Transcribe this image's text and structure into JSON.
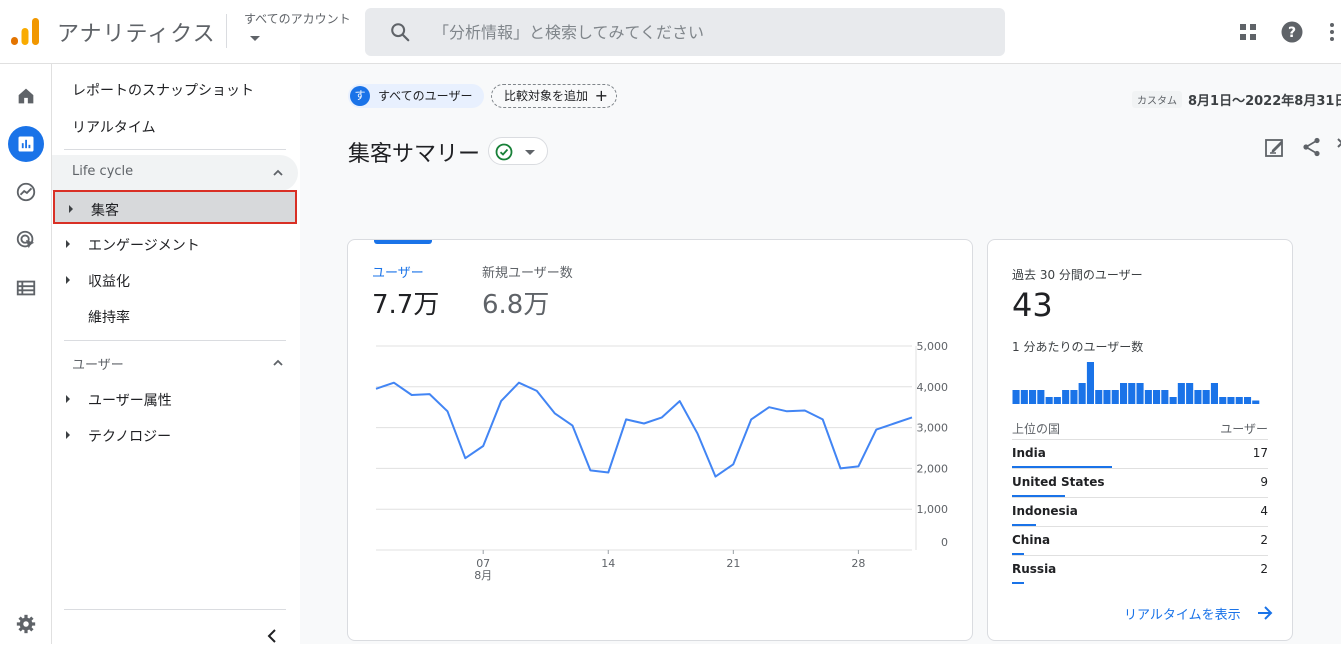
{
  "header": {
    "app_title": "アナリティクス",
    "account_label": "すべてのアカウント",
    "search_placeholder": "「分析情報」と検索してみてください"
  },
  "sidebar": {
    "top_items": [
      "レポートのスナップショット",
      "リアルタイム"
    ],
    "sections": [
      {
        "title": "Life cycle",
        "items": [
          "集客",
          "エンゲージメント",
          "収益化",
          "維持率"
        ]
      },
      {
        "title": "ユーザー",
        "items": [
          "ユーザー属性",
          "テクノロジー"
        ]
      }
    ],
    "selected_item": "集客"
  },
  "toolbar": {
    "user_chip_avatar": "す",
    "user_chip_label": "すべてのユーザー",
    "compare_label": "比較対象を追加",
    "compare_plus": "+",
    "date_badge": "カスタム",
    "date_range": "8月1日〜2022年8月31日"
  },
  "page": {
    "title": "集客サマリー"
  },
  "metrics": [
    {
      "label": "ユーザー",
      "value": "7.7万"
    },
    {
      "label": "新規ユーザー数",
      "value": "6.8万"
    }
  ],
  "chart_data": {
    "type": "line",
    "x_ticks": [
      {
        "day": 7,
        "label": "07",
        "sublabel": "8月"
      },
      {
        "day": 14,
        "label": "14"
      },
      {
        "day": 21,
        "label": "21"
      },
      {
        "day": 28,
        "label": "28"
      }
    ],
    "y_ticks": [
      "5,000",
      "4,000",
      "3,000",
      "2,000",
      "1,000",
      "0"
    ],
    "ylim": [
      0,
      5000
    ],
    "x": [
      1,
      2,
      3,
      4,
      5,
      6,
      7,
      8,
      9,
      10,
      11,
      12,
      13,
      14,
      15,
      16,
      17,
      18,
      19,
      20,
      21,
      22,
      23,
      24,
      25,
      26,
      27,
      28,
      29,
      30,
      31
    ],
    "values": [
      3950,
      4100,
      3800,
      3820,
      3400,
      2250,
      2550,
      3650,
      4100,
      3900,
      3350,
      3050,
      1950,
      1900,
      3200,
      3100,
      3250,
      3650,
      2850,
      1800,
      2100,
      3200,
      3500,
      3400,
      3420,
      3200,
      2000,
      2050,
      2950,
      3100,
      3250
    ],
    "color": "#4285f4"
  },
  "realtime": {
    "title": "過去 30 分間のユーザー",
    "value": "43",
    "per_minute_label": "1 分あたりのユーザー数",
    "per_minute_values": [
      2,
      2,
      2,
      2,
      1,
      1,
      2,
      2,
      3,
      6,
      2,
      2,
      2,
      3,
      3,
      3,
      2,
      2,
      2,
      1,
      3,
      3,
      2,
      2,
      3,
      1,
      1,
      1,
      1,
      0.5
    ],
    "table_header_country": "上位の国",
    "table_header_users": "ユーザー",
    "countries": [
      {
        "name": "India",
        "value": "17",
        "share": 1.0
      },
      {
        "name": "United States",
        "value": "9",
        "share": 0.53
      },
      {
        "name": "Indonesia",
        "value": "4",
        "share": 0.24
      },
      {
        "name": "China",
        "value": "2",
        "share": 0.12
      },
      {
        "name": "Russia",
        "value": "2",
        "share": 0.12
      }
    ],
    "link_label": "リアルタイムを表示"
  },
  "colors": {
    "accent": "#1a73e8",
    "highlight_border": "#d93025"
  }
}
